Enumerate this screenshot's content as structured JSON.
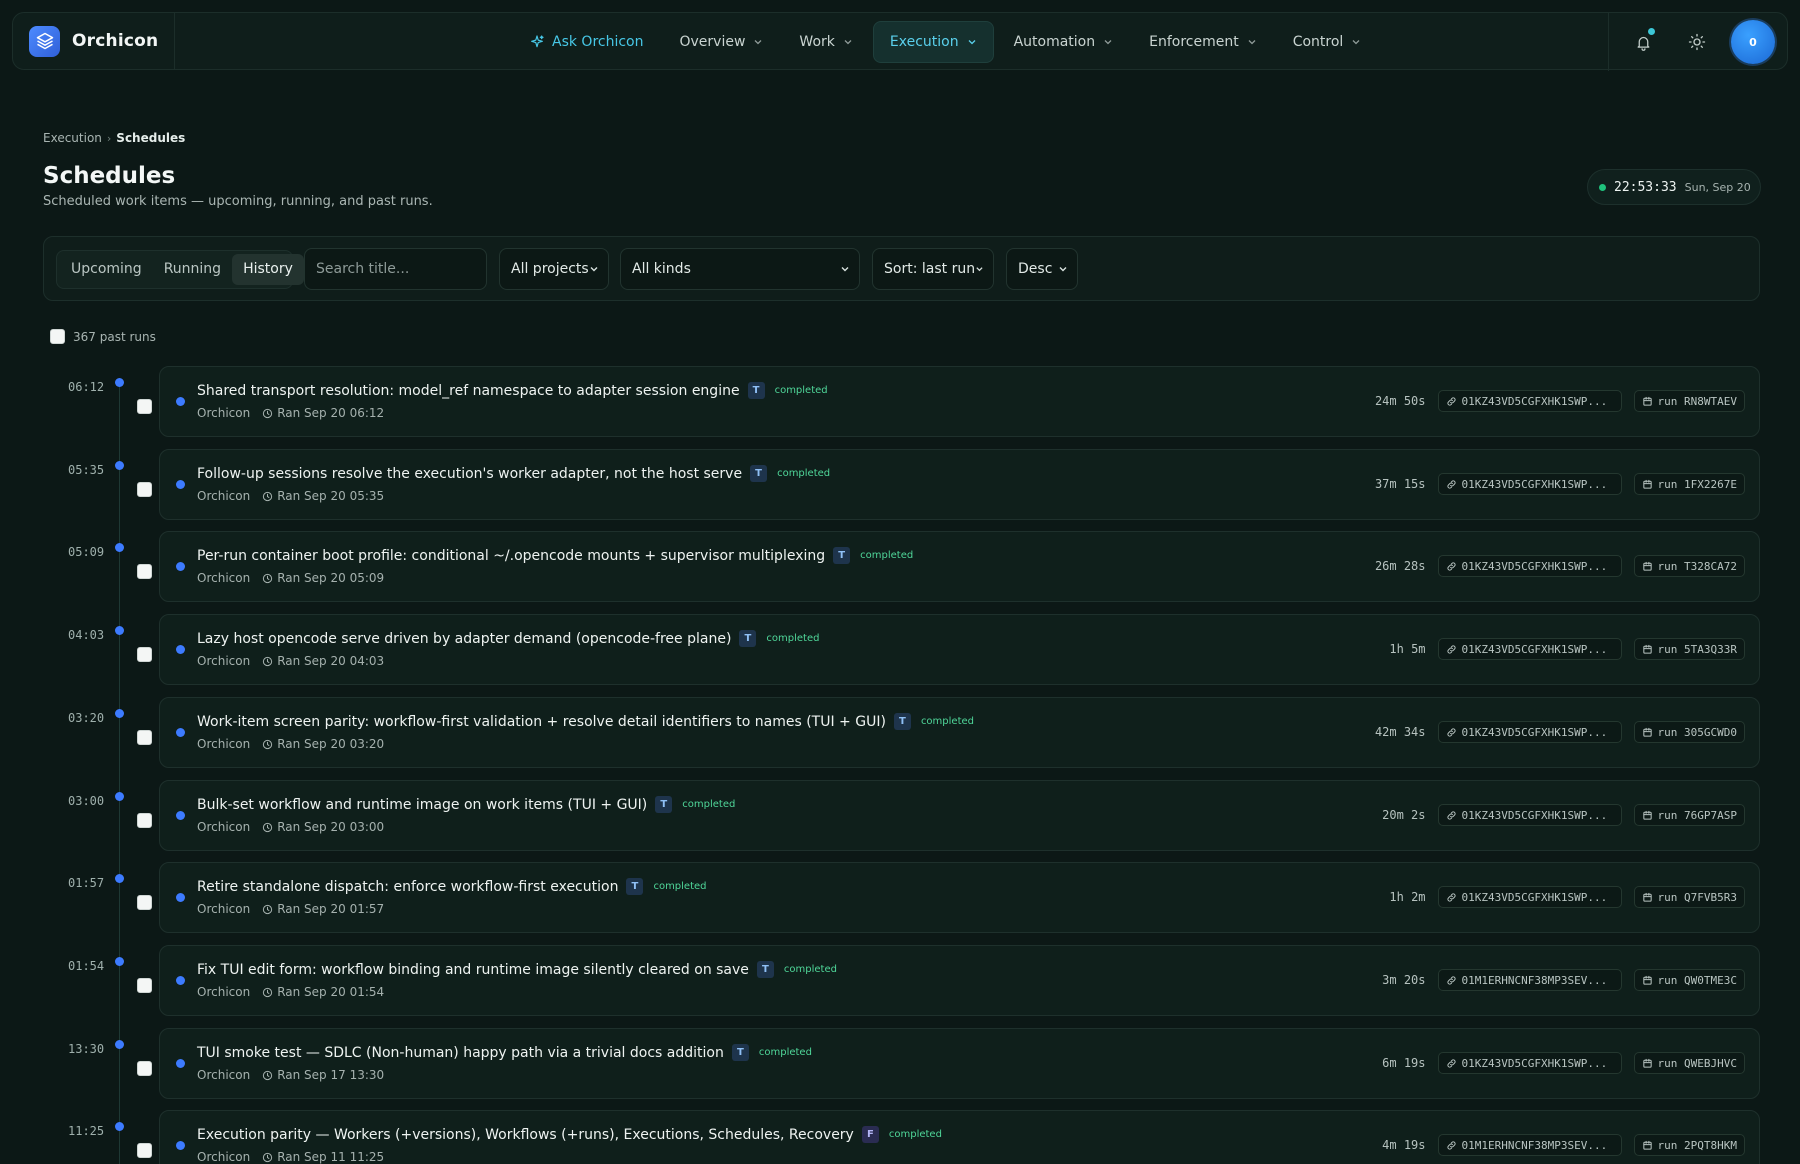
{
  "app": {
    "name": "Orchicon"
  },
  "nav": {
    "ask": "Ask Orchicon",
    "items": [
      "Overview",
      "Work",
      "Execution",
      "Automation",
      "Enforcement",
      "Control"
    ],
    "active": "Execution",
    "avatar_initial": "0"
  },
  "breadcrumb": {
    "parent": "Execution",
    "current": "Schedules"
  },
  "page": {
    "title": "Schedules",
    "subtitle": "Scheduled work items — upcoming, running, and past runs."
  },
  "clock": {
    "time": "22:53:33",
    "date": "Sun, Sep 20"
  },
  "filters": {
    "tabs": [
      "Upcoming",
      "Running",
      "History"
    ],
    "active_tab": "History",
    "search_placeholder": "Search title...",
    "project": "All projects",
    "kind": "All kinds",
    "sort": "Sort: last run",
    "order": "Desc"
  },
  "list": {
    "count_label": "367 past runs",
    "runs": [
      {
        "time": "06:12",
        "title": "Shared transport resolution: model_ref namespace to adapter session engine",
        "kind": "T",
        "status": "completed",
        "project": "Orchicon",
        "ran": "Ran Sep 20 06:12",
        "duration": "24m 50s",
        "workflow": "01KZ43VD5CGFXHK1SWP...",
        "run": "run RN8WTAEV"
      },
      {
        "time": "05:35",
        "title": "Follow-up sessions resolve the execution's worker adapter, not the host serve",
        "kind": "T",
        "status": "completed",
        "project": "Orchicon",
        "ran": "Ran Sep 20 05:35",
        "duration": "37m 15s",
        "workflow": "01KZ43VD5CGFXHK1SWP...",
        "run": "run 1FX2267E"
      },
      {
        "time": "05:09",
        "title": "Per-run container boot profile: conditional ~/.opencode mounts + supervisor multiplexing",
        "kind": "T",
        "status": "completed",
        "project": "Orchicon",
        "ran": "Ran Sep 20 05:09",
        "duration": "26m 28s",
        "workflow": "01KZ43VD5CGFXHK1SWP...",
        "run": "run T328CA72"
      },
      {
        "time": "04:03",
        "title": "Lazy host opencode serve driven by adapter demand (opencode-free plane)",
        "kind": "T",
        "status": "completed",
        "project": "Orchicon",
        "ran": "Ran Sep 20 04:03",
        "duration": "1h 5m",
        "workflow": "01KZ43VD5CGFXHK1SWP...",
        "run": "run 5TA3Q33R"
      },
      {
        "time": "03:20",
        "title": "Work-item screen parity: workflow-first validation + resolve detail identifiers to names (TUI + GUI)",
        "kind": "T",
        "status": "completed",
        "project": "Orchicon",
        "ran": "Ran Sep 20 03:20",
        "duration": "42m 34s",
        "workflow": "01KZ43VD5CGFXHK1SWP...",
        "run": "run 305GCWD0"
      },
      {
        "time": "03:00",
        "title": "Bulk-set workflow and runtime image on work items (TUI + GUI)",
        "kind": "T",
        "status": "completed",
        "project": "Orchicon",
        "ran": "Ran Sep 20 03:00",
        "duration": "20m 2s",
        "workflow": "01KZ43VD5CGFXHK1SWP...",
        "run": "run 76GP7ASP"
      },
      {
        "time": "01:57",
        "title": "Retire standalone dispatch: enforce workflow-first execution",
        "kind": "T",
        "status": "completed",
        "project": "Orchicon",
        "ran": "Ran Sep 20 01:57",
        "duration": "1h 2m",
        "workflow": "01KZ43VD5CGFXHK1SWP...",
        "run": "run Q7FVB5R3"
      },
      {
        "time": "01:54",
        "title": "Fix TUI edit form: workflow binding and runtime image silently cleared on save",
        "kind": "T",
        "status": "completed",
        "project": "Orchicon",
        "ran": "Ran Sep 20 01:54",
        "duration": "3m 20s",
        "workflow": "01M1ERHNCNF38MP3SEV...",
        "run": "run QW0TME3C"
      },
      {
        "time": "13:30",
        "title": "TUI smoke test — SDLC (Non-human) happy path via a trivial docs addition",
        "kind": "T",
        "status": "completed",
        "project": "Orchicon",
        "ran": "Ran Sep 17 13:30",
        "duration": "6m 19s",
        "workflow": "01KZ43VD5CGFXHK1SWP...",
        "run": "run QWEBJHVC"
      },
      {
        "time": "11:25",
        "title": "Execution parity — Workers (+versions), Workflows (+runs), Executions, Schedules, Recovery",
        "kind": "F",
        "status": "completed",
        "project": "Orchicon",
        "ran": "Ran Sep 11 11:25",
        "duration": "4m 19s",
        "workflow": "01M1ERHNCNF38MP3SEV...",
        "run": "run 2PQT8HKM"
      }
    ]
  }
}
